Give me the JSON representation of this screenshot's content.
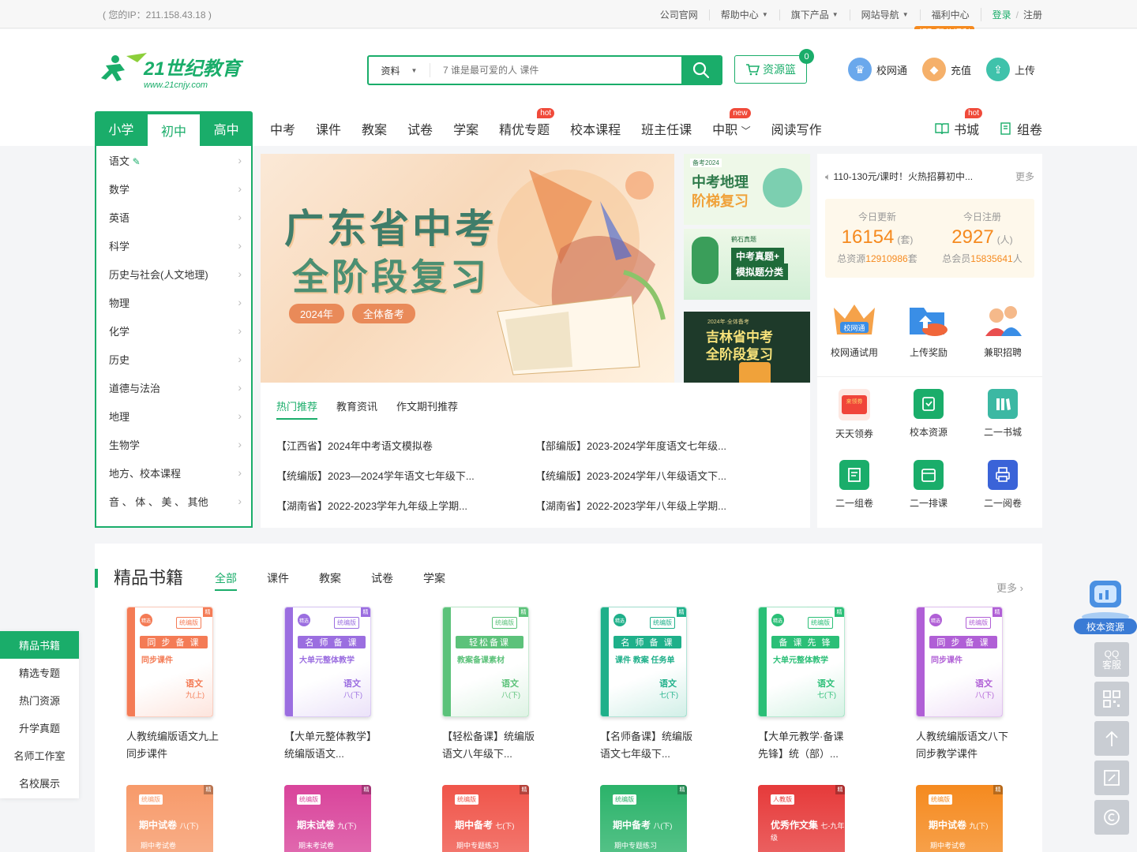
{
  "topbar": {
    "ip_text": "( 您的IP：211.158.43.18 )",
    "links": [
      "公司官网",
      "帮助中心",
      "旗下产品",
      "网站导航",
      "福利中心"
    ],
    "dropdown_flags": [
      false,
      true,
      true,
      true,
      false
    ],
    "login": "登录",
    "separator": "/",
    "register": "注册",
    "fuli_badge": "领取积分福利"
  },
  "header": {
    "logo_text": "21世纪教育",
    "logo_url_text": "www.21cnjy.com",
    "search": {
      "type_label": "资料",
      "placeholder": "7 谁是最可爱的人 课件"
    },
    "basket": {
      "label": "资源篮",
      "count": "0"
    },
    "actions": [
      {
        "label": "校网通",
        "icon": "crown-icon",
        "color": "#4a90e2"
      },
      {
        "label": "充值",
        "icon": "diamond-icon",
        "color": "#f5a24a"
      },
      {
        "label": "上传",
        "icon": "upload-icon",
        "color": "#2fbba0"
      }
    ]
  },
  "stage_tabs": [
    "小学",
    "初中",
    "高中"
  ],
  "stage_active": 1,
  "main_nav": [
    {
      "label": "中考",
      "tag": ""
    },
    {
      "label": "课件",
      "tag": ""
    },
    {
      "label": "教案",
      "tag": ""
    },
    {
      "label": "试卷",
      "tag": ""
    },
    {
      "label": "学案",
      "tag": ""
    },
    {
      "label": "精优专题",
      "tag": "hot"
    },
    {
      "label": "校本课程",
      "tag": ""
    },
    {
      "label": "班主任课",
      "tag": ""
    },
    {
      "label": "中职",
      "tag": "new"
    },
    {
      "label": "阅读写作",
      "tag": ""
    }
  ],
  "right_nav": [
    {
      "label": "书城",
      "tag": "hot",
      "icon": "book-icon"
    },
    {
      "label": "组卷",
      "icon": "paper-icon",
      "tag": ""
    }
  ],
  "subjects": [
    "语文",
    "数学",
    "英语",
    "科学",
    "历史与社会(人文地理)",
    "物理",
    "化学",
    "历史",
    "道德与法治",
    "地理",
    "生物学",
    "地方、校本课程",
    "音 、 体 、 美 、 其他"
  ],
  "banner": {
    "line1": "广东省中考",
    "line2": "全阶段复习",
    "tag_year": "2024年",
    "tag_prep": "全体备考"
  },
  "thumbs": [
    {
      "title": "中考地理",
      "subtitle": "阶梯复习",
      "head": "备考2024"
    },
    {
      "title": "中考真题+",
      "subtitle": "模拟题分类",
      "head": "鹤石真题"
    },
    {
      "title": "吉林省中考",
      "subtitle": "全阶段复习",
      "head": "2024年·全体备考"
    }
  ],
  "news": {
    "tabs": [
      "热门推荐",
      "教育资讯",
      "作文期刊推荐"
    ],
    "active": 0,
    "items": [
      "【江西省】2024年中考语文模拟卷",
      "【部编版】2023-2024学年度语文七年级...",
      "【统编版】2023—2024学年语文七年级下...",
      "【统编版】2023-2024学年八年级语文下...",
      "【湖南省】2022-2023学年九年级上学期...",
      "【湖南省】2022-2023学年八年级上学期..."
    ]
  },
  "right_panel": {
    "notice": "110-130元/课时！火热招募初中...",
    "more": "更多",
    "stats": [
      {
        "label": "今日更新",
        "value": "16154",
        "unit": "(套)",
        "total_label": "总资源",
        "total": "12910986",
        "total_unit": "套"
      },
      {
        "label": "今日注册",
        "value": "2927",
        "unit": "(人)",
        "total_label": "总会员",
        "total": "15835641",
        "total_unit": "人"
      }
    ],
    "promo": [
      {
        "label": "校网通试用",
        "icon": "crown-icon"
      },
      {
        "label": "上传奖励",
        "icon": "folder-upload-icon"
      },
      {
        "label": "兼职招聘",
        "icon": "people-icon"
      }
    ],
    "tools": [
      {
        "label": "天天领券",
        "icon": "coupon-icon",
        "color": "#f0453a"
      },
      {
        "label": "校本资源",
        "icon": "school-resource-icon",
        "color": "#1aad6a"
      },
      {
        "label": "二一书城",
        "icon": "bookshelf-icon",
        "color": "#3cb8a3"
      },
      {
        "label": "二一组卷",
        "icon": "exam-compose-icon",
        "color": "#1aad6a"
      },
      {
        "label": "二一排课",
        "icon": "schedule-icon",
        "color": "#1aad6a"
      },
      {
        "label": "二一阅卷",
        "icon": "print-icon",
        "color": "#3a63d8"
      }
    ]
  },
  "books": {
    "title": "精品书籍",
    "tabs": [
      "全部",
      "课件",
      "教案",
      "试卷",
      "学案"
    ],
    "active": 0,
    "more": "更多",
    "items": [
      {
        "title": "人教统编版语文九上 同步课件",
        "series": "同 步 备 课",
        "sub": "同步课件",
        "subject": "语文",
        "grade": "九(上)",
        "color": "#f47b55",
        "tag": "统编版",
        "corner": "精选备课"
      },
      {
        "title": "【大单元整体教学】统编版语文...",
        "series": "名 师 备 课",
        "sub": "大单元整体教学",
        "subject": "语文",
        "grade": "八(下)",
        "color": "#9b6ee0",
        "tag": "统编版",
        "corner": "精选备课"
      },
      {
        "title": "【轻松备课】统编版语文八年级下...",
        "series": "轻松备课",
        "sub": "教案备课素材",
        "subject": "语文",
        "grade": "八(下)",
        "color": "#5cc27a",
        "tag": "统编版",
        "corner": ""
      },
      {
        "title": "【名师备课】统编版语文七年级下...",
        "series": "名 师 备 课",
        "sub": "课件 教案 任务单",
        "subject": "语文",
        "grade": "七(下)",
        "color": "#1fb08a",
        "tag": "统编版",
        "corner": "精选备课"
      },
      {
        "title": "【大单元教学·备课先锋】统（部）...",
        "series": "备 课 先 锋",
        "sub": "大单元整体教学",
        "subject": "语文",
        "grade": "七(下)",
        "color": "#2bbf77",
        "tag": "统编版",
        "corner": "精选备课"
      },
      {
        "title": "人教统编版语文八下 同步教学课件",
        "series": "同 步 备 课",
        "sub": "同步课件",
        "subject": "语文",
        "grade": "八(下)",
        "color": "#b05fd6",
        "tag": "统编版",
        "corner": "精选备课"
      }
    ],
    "row2": [
      {
        "title": "期中试卷",
        "grade": "八(下)",
        "sub": "期中考试卷",
        "tag": "统编版",
        "color": "#f79a6a"
      },
      {
        "title": "期末试卷",
        "grade": "九(下)",
        "sub": "期末考试卷",
        "tag": "统编版",
        "color": "#d9449b"
      },
      {
        "title": "期中备考",
        "grade": "七(下)",
        "sub": "期中专题练习",
        "tag": "统编版",
        "color": "#f0554a"
      },
      {
        "title": "期中备考",
        "grade": "八(下)",
        "sub": "期中专题练习",
        "tag": "统编版",
        "color": "#2bb36a"
      },
      {
        "title": "优秀作文集",
        "grade": "七-九年级",
        "sub": "",
        "tag": "人教版",
        "color": "#e63a3a"
      },
      {
        "title": "期中试卷",
        "grade": "九(下)",
        "sub": "期中考试卷",
        "tag": "统编版",
        "color": "#f58a1f"
      }
    ]
  },
  "left_float": [
    "精品书籍",
    "精选专题",
    "热门资源",
    "升学真题",
    "名师工作室",
    "名校展示"
  ],
  "left_float_active": 0,
  "right_float": {
    "resource_label": "校本资源",
    "qq_label_1": "QQ",
    "qq_label_2": "客服"
  }
}
